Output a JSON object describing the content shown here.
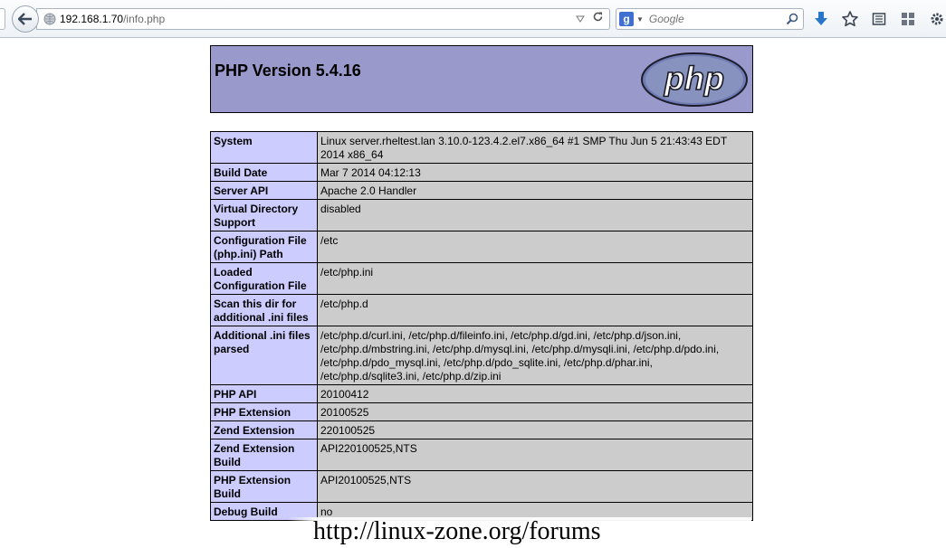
{
  "browser": {
    "url_host": "192.168.1.70",
    "url_path": "/info.php",
    "search_placeholder": "Google",
    "search_engine_letter": "g"
  },
  "page": {
    "title": "PHP Version 5.4.16",
    "logo_text": "php",
    "rows": [
      {
        "key": "System",
        "value": "Linux server.rheltest.lan 3.10.0-123.4.2.el7.x86_64 #1 SMP Thu Jun 5 21:43:43 EDT 2014 x86_64"
      },
      {
        "key": "Build Date",
        "value": "Mar 7 2014 04:12:13"
      },
      {
        "key": "Server API",
        "value": "Apache 2.0 Handler"
      },
      {
        "key": "Virtual Directory Support",
        "value": "disabled"
      },
      {
        "key": "Configuration File (php.ini) Path",
        "value": "/etc"
      },
      {
        "key": "Loaded Configuration File",
        "value": "/etc/php.ini"
      },
      {
        "key": "Scan this dir for additional .ini files",
        "value": "/etc/php.d"
      },
      {
        "key": "Additional .ini files parsed",
        "value": "/etc/php.d/curl.ini, /etc/php.d/fileinfo.ini, /etc/php.d/gd.ini, /etc/php.d/json.ini, /etc/php.d/mbstring.ini, /etc/php.d/mysql.ini, /etc/php.d/mysqli.ini, /etc/php.d/pdo.ini, /etc/php.d/pdo_mysql.ini, /etc/php.d/pdo_sqlite.ini, /etc/php.d/phar.ini, /etc/php.d/sqlite3.ini, /etc/php.d/zip.ini"
      },
      {
        "key": "PHP API",
        "value": "20100412"
      },
      {
        "key": "PHP Extension",
        "value": "20100525"
      },
      {
        "key": "Zend Extension",
        "value": "220100525"
      },
      {
        "key": "Zend Extension Build",
        "value": "API220100525,NTS"
      },
      {
        "key": "PHP Extension Build",
        "value": "API20100525,NTS"
      },
      {
        "key": "Debug Build",
        "value": "no"
      }
    ]
  },
  "watermark": {
    "text": "http://linux-zone.org/forums"
  }
}
